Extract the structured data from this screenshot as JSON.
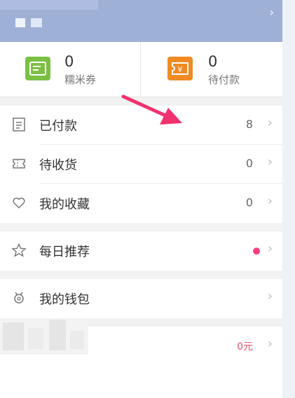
{
  "coupons": [
    {
      "count": "0",
      "label": "糯米券",
      "icon": "coupon-icon",
      "color": "#7cc043"
    },
    {
      "count": "0",
      "label": "待付款",
      "icon": "yen-ticket-icon",
      "color": "#f08a22"
    }
  ],
  "orders": [
    {
      "label": "已付款",
      "value": "8",
      "icon": "receipt-icon"
    },
    {
      "label": "待收货",
      "value": "0",
      "icon": "ticket-icon"
    },
    {
      "label": "我的收藏",
      "value": "0",
      "icon": "heart-icon"
    }
  ],
  "daily": {
    "label": "每日推荐",
    "icon": "star-icon"
  },
  "wallet": {
    "label": "我的钱包",
    "icon": "wallet-icon"
  },
  "bottom_row": {
    "value": "0元"
  },
  "colors": {
    "header": "#9fb0d6",
    "accent": "#ff3d7a",
    "arrow": "#f2326f"
  }
}
